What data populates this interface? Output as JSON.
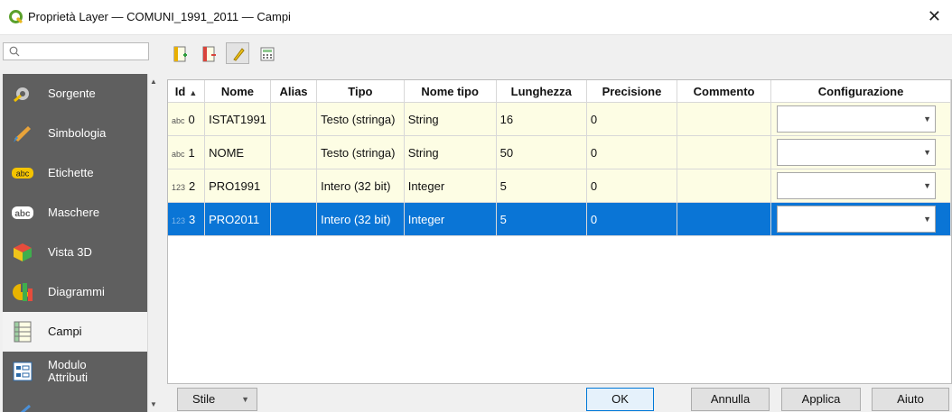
{
  "window": {
    "title": "Proprietà Layer — COMUNI_1991_2011 — Campi"
  },
  "search": {
    "placeholder": ""
  },
  "sidebar": {
    "items": [
      {
        "label": "Sorgente",
        "icon": "source-icon",
        "active": false
      },
      {
        "label": "Simbologia",
        "icon": "symbology-icon",
        "active": false
      },
      {
        "label": "Etichette",
        "icon": "labels-icon",
        "active": false
      },
      {
        "label": "Maschere",
        "icon": "masks-icon",
        "active": false
      },
      {
        "label": "Vista 3D",
        "icon": "3d-view-icon",
        "active": false
      },
      {
        "label": "Diagrammi",
        "icon": "diagrams-icon",
        "active": false
      },
      {
        "label": "Campi",
        "icon": "fields-icon",
        "active": true
      },
      {
        "label_line1": "Modulo",
        "label_line2": "Attributi",
        "icon": "attributes-form-icon",
        "active": false
      }
    ]
  },
  "toolbar": {
    "buttons": [
      "new-field-icon",
      "delete-field-icon",
      "toggle-editing-icon",
      "field-calculator-icon"
    ]
  },
  "table": {
    "headers": [
      "Id",
      "Nome",
      "Alias",
      "Tipo",
      "Nome tipo",
      "Lunghezza",
      "Precisione",
      "Commento",
      "Configurazione"
    ],
    "rows": [
      {
        "type_badge": "abc",
        "id": "0",
        "nome": "ISTAT1991",
        "alias": "",
        "tipo": "Testo (stringa)",
        "nome_tipo": "String",
        "lunghezza": "16",
        "precisione": "0",
        "commento": "",
        "configurazione": "",
        "selected": false
      },
      {
        "type_badge": "abc",
        "id": "1",
        "nome": "NOME",
        "alias": "",
        "tipo": "Testo (stringa)",
        "nome_tipo": "String",
        "lunghezza": "50",
        "precisione": "0",
        "commento": "",
        "configurazione": "",
        "selected": false
      },
      {
        "type_badge": "123",
        "id": "2",
        "nome": "PRO1991",
        "alias": "",
        "tipo": "Intero (32 bit)",
        "nome_tipo": "Integer",
        "lunghezza": "5",
        "precisione": "0",
        "commento": "",
        "configurazione": "",
        "selected": false
      },
      {
        "type_badge": "123",
        "id": "3",
        "nome": "PRO2011",
        "alias": "",
        "tipo": "Intero (32 bit)",
        "nome_tipo": "Integer",
        "lunghezza": "5",
        "precisione": "0",
        "commento": "",
        "configurazione": "",
        "selected": true
      }
    ]
  },
  "buttons": {
    "style": "Stile",
    "ok": "OK",
    "cancel": "Annulla",
    "apply": "Applica",
    "help": "Aiuto"
  },
  "colors": {
    "row_bg": "#fdfde4",
    "selection": "#0a75d6",
    "sidebar_bg": "#5f5f5f"
  }
}
